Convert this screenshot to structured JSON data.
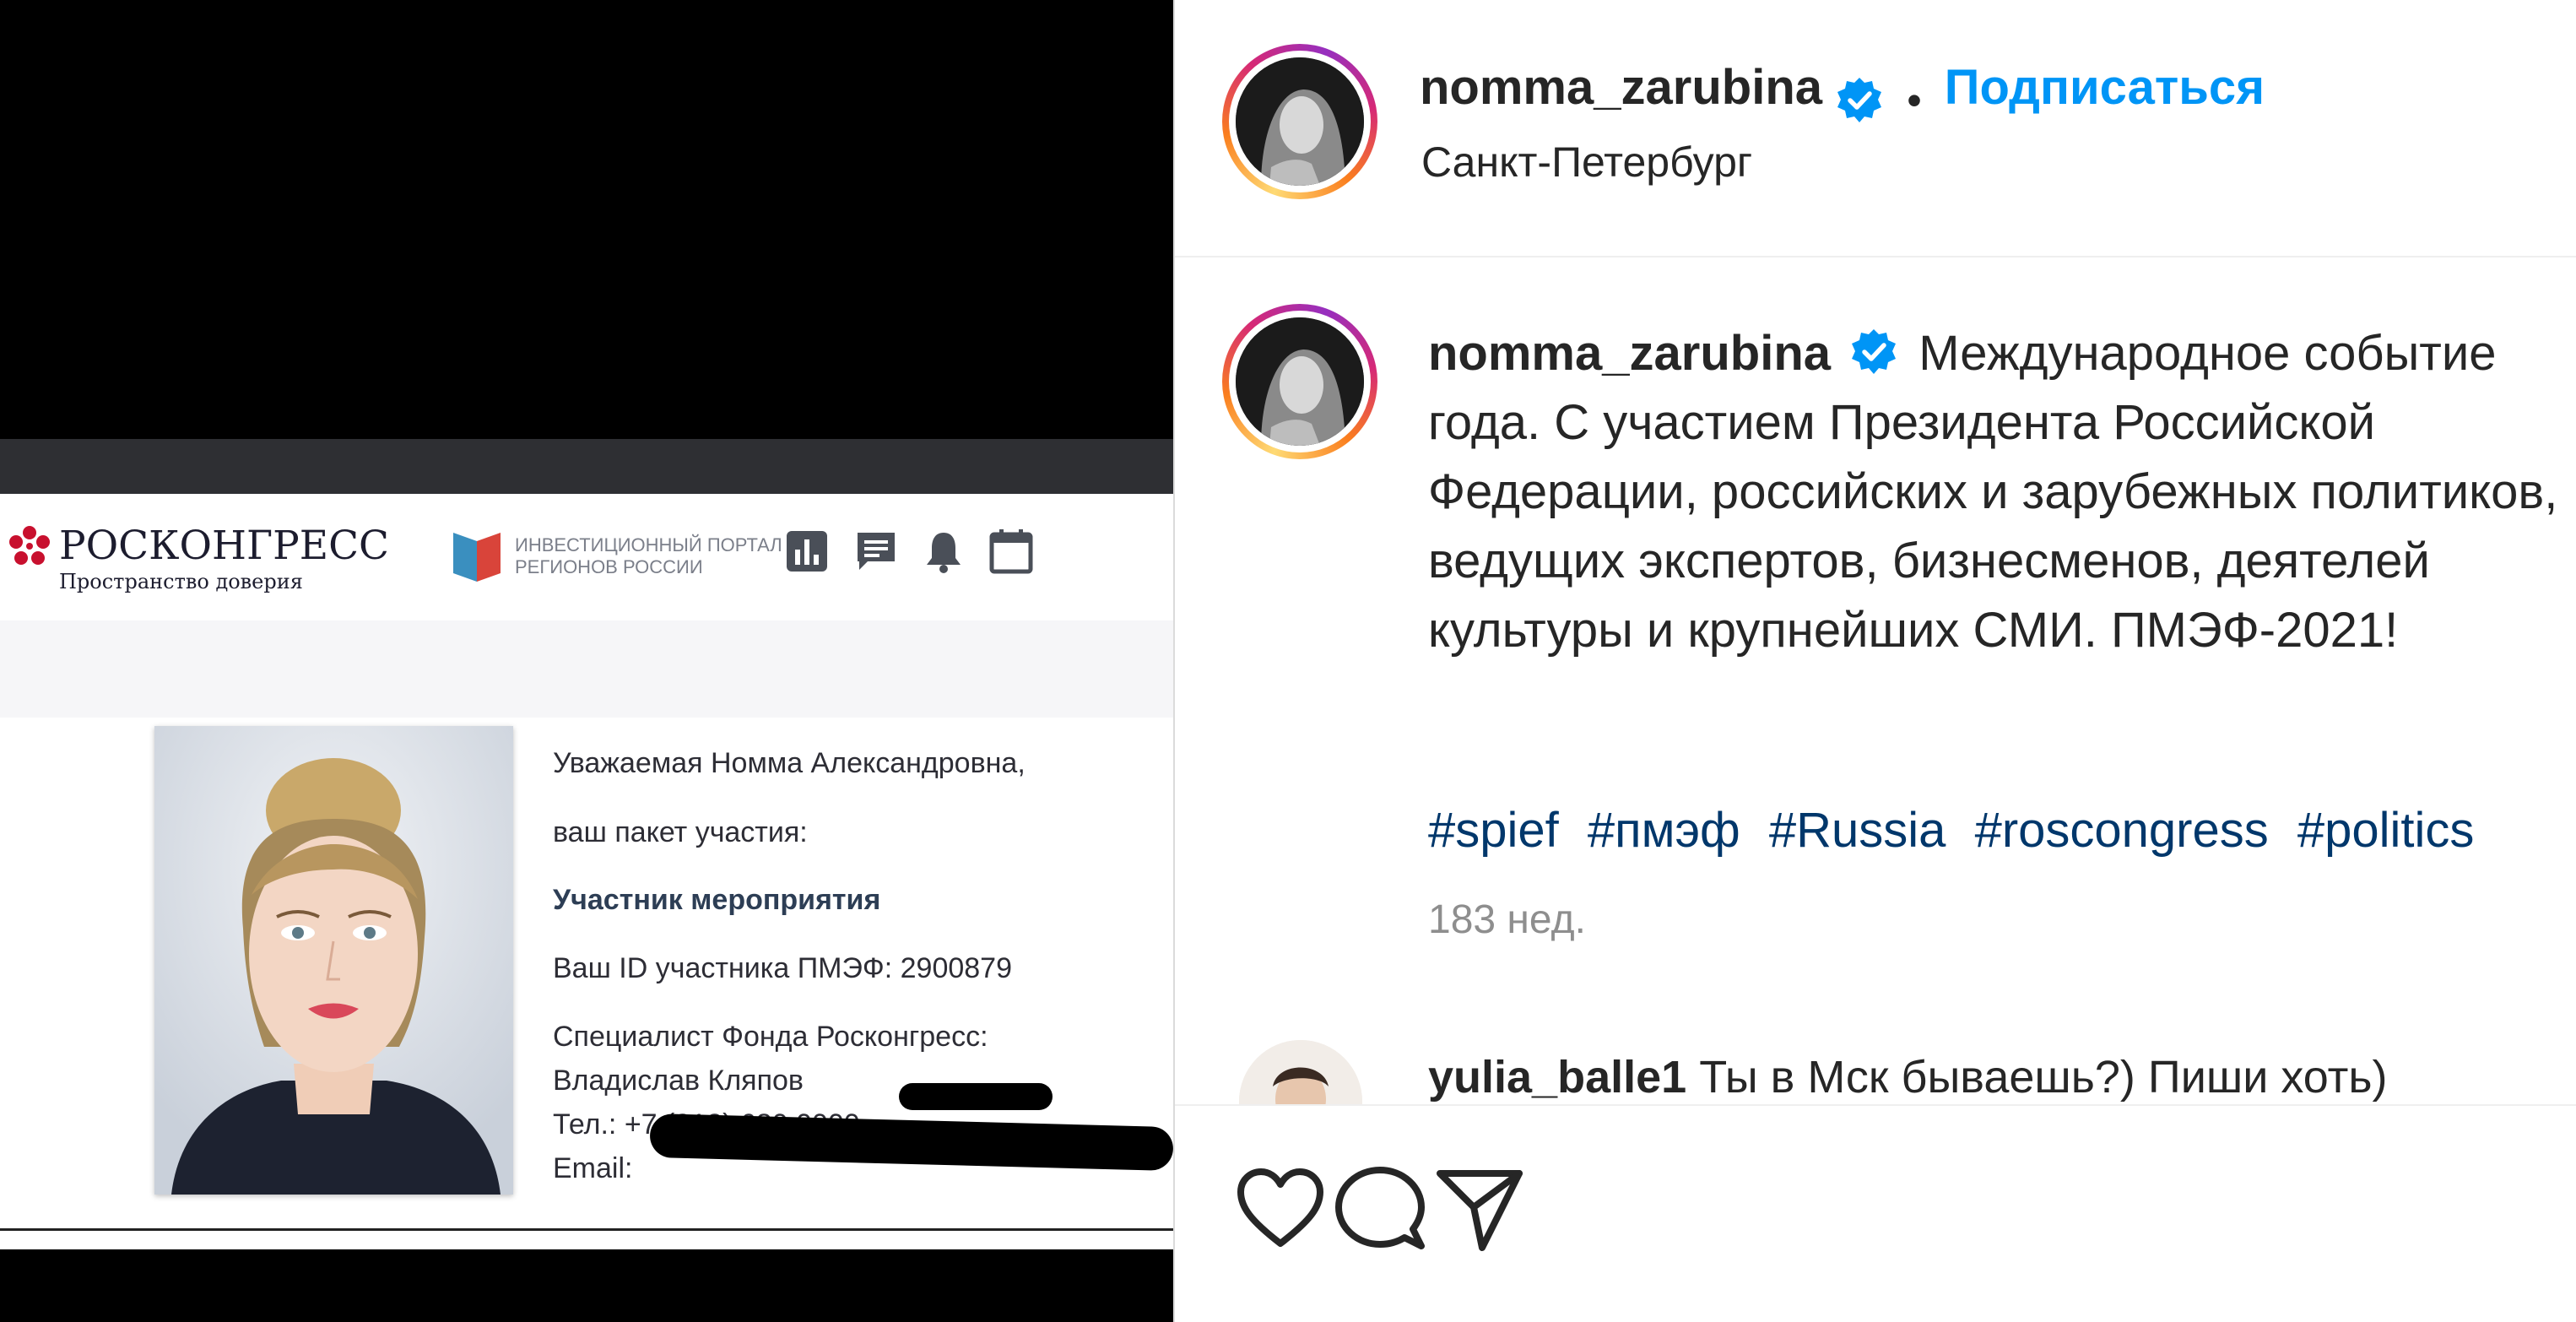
{
  "post_image": {
    "roscongress": {
      "logo_title": "РОСКОНГРЕСС",
      "logo_subtitle": "Пространство доверия"
    },
    "portal": {
      "line1": "ИНВЕСТИЦИОННЫЙ ПОРТАЛ",
      "line2": "РЕГИОНОВ РОССИИ"
    },
    "toolbar_icons": [
      "bar-chart-icon",
      "chat-icon",
      "bell-icon",
      "calendar-icon"
    ],
    "letter": {
      "greeting": "Уважаемая Номма Александровна,",
      "package_label": "ваш пакет участия:",
      "package_value": "Участник мероприятия",
      "participant_id": "Ваш ID участника ПМЭФ: 2900879",
      "specialist_label": "Специалист Фонда Росконгресс:",
      "specialist_name": "Владислав Кляпов",
      "phone": "Тел.: +7 (812) 680 0000, ",
      "email": "Email: "
    }
  },
  "header": {
    "username": "nomma_zarubina",
    "separator": "•",
    "follow_label": "Подписаться",
    "location": "Санкт-Петербург"
  },
  "caption": {
    "username": "nomma_zarubina",
    "text": "Международное событие года. С участием Президента Российской Федерации, российских и зарубежных политиков, ведущих экспертов, бизнесменов, деятелей культуры и крупнейших СМИ. ПМЭФ-2021!",
    "hashtags": [
      "#spief",
      "#пмэф",
      "#Russia",
      "#roscongress",
      "#politics"
    ],
    "time_ago": "183 нед."
  },
  "comment": {
    "username": "yulia_balle1",
    "text": "Ты в Мск бываешь?) Пиши хоть)"
  },
  "actions": [
    "heart-icon",
    "comment-icon",
    "share-icon"
  ],
  "colors": {
    "follow_blue": "#0095f6",
    "hashtag_blue": "#00376b",
    "verified_blue": "#0095f6",
    "muted_grey": "#8e8e8e"
  }
}
